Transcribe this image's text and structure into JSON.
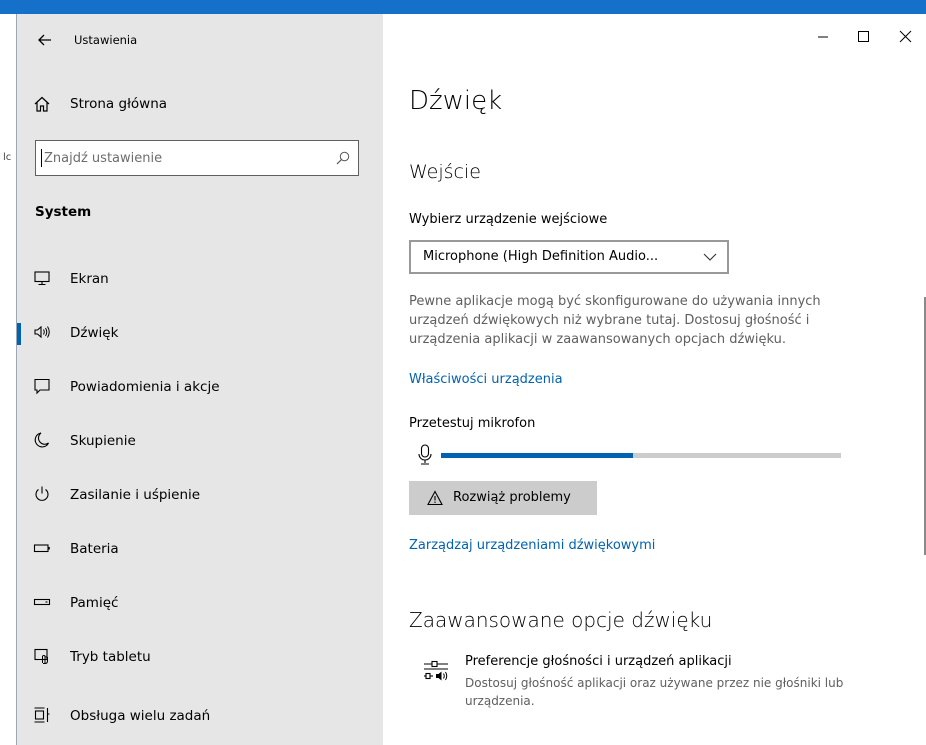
{
  "window": {
    "app_title": "Ustawienia",
    "edge_text": "lc"
  },
  "sidebar": {
    "home_label": "Strona główna",
    "search_placeholder": "Znajdź ustawienie",
    "section_title": "System",
    "items": [
      {
        "label": "Ekran",
        "icon": "monitor-icon"
      },
      {
        "label": "Dźwięk",
        "icon": "speaker-icon",
        "active": true
      },
      {
        "label": "Powiadomienia i akcje",
        "icon": "notification-icon"
      },
      {
        "label": "Skupienie",
        "icon": "moon-icon"
      },
      {
        "label": "Zasilanie i uśpienie",
        "icon": "power-icon"
      },
      {
        "label": "Bateria",
        "icon": "battery-icon"
      },
      {
        "label": "Pamięć",
        "icon": "storage-icon"
      },
      {
        "label": "Tryb tabletu",
        "icon": "tablet-mode-icon"
      },
      {
        "label": "Obsługa wielu zadań",
        "icon": "multitasking-icon"
      }
    ]
  },
  "main": {
    "page_title": "Dźwięk",
    "input_heading": "Wejście",
    "choose_device_label": "Wybierz urządzenie wejściowe",
    "device_value": "Microphone (High Definition Audio...",
    "description": "Pewne aplikacje mogą być skonfigurowane do używania innych urządzeń dźwiękowych niż wybrane tutaj. Dostosuj głośność i urządzenia aplikacji w zaawansowanych opcjach dźwięku.",
    "device_properties_link": "Właściwości urządzenia",
    "test_mic_label": "Przetestuj mikrofon",
    "mic_level": 0.48,
    "troubleshoot_label": "Rozwiąż problemy",
    "manage_devices_link": "Zarządzaj urządzeniami dźwiękowymi",
    "advanced_heading": "Zaawansowane opcje dźwięku",
    "app_volume_title": "Preferencje głośności i urządzeń aplikacji",
    "app_volume_desc": "Dostosuj głośność aplikacji oraz używane przez nie głośniki lub urządzenia."
  },
  "colors": {
    "accent": "#0063b1",
    "sidebar_bg": "#e6e6e6",
    "taskbar_blue": "#1570c9"
  }
}
